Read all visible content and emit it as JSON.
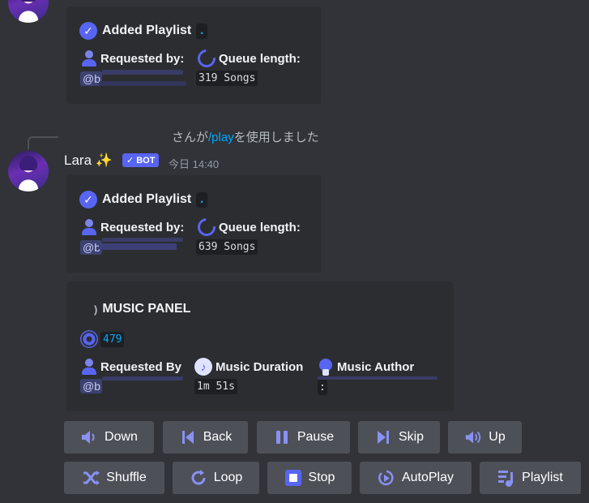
{
  "message_top": {
    "embed": {
      "title": "Added Playlist",
      "title_code": ".",
      "requested_label": "Requested by:",
      "mention": "@b",
      "queue_label": "Queue length:",
      "queue_value": "319 Songs"
    }
  },
  "system_line": {
    "prefix": "さんが",
    "command": "/play",
    "suffix": "を使用しました"
  },
  "message_main": {
    "author": "Lara",
    "author_emoji": "✨",
    "bot_tag": "BOT",
    "timestamp": "今日 14:40",
    "embed1": {
      "title": "Added Playlist",
      "title_code": ".",
      "requested_label": "Requested by:",
      "mention": "@b",
      "queue_label": "Queue length:",
      "queue_value": "639 Songs"
    },
    "embed2": {
      "title": "MUSIC PANEL",
      "track_number": "479",
      "requested_label": "Requested By",
      "mention": "@b",
      "duration_label": "Music Duration",
      "duration_value": "1m 51s",
      "author_label": "Music Author",
      "author_value": ":"
    }
  },
  "buttons_row1": [
    {
      "label": "Down",
      "icon": "volume-down-icon"
    },
    {
      "label": "Back",
      "icon": "previous-track-icon"
    },
    {
      "label": "Pause",
      "icon": "pause-icon"
    },
    {
      "label": "Skip",
      "icon": "next-track-icon"
    },
    {
      "label": "Up",
      "icon": "volume-up-icon"
    }
  ],
  "buttons_row2": [
    {
      "label": "Shuffle",
      "icon": "shuffle-icon"
    },
    {
      "label": "Loop",
      "icon": "loop-icon"
    },
    {
      "label": "Stop",
      "icon": "stop-icon"
    },
    {
      "label": "AutoPlay",
      "icon": "autoplay-icon"
    },
    {
      "label": "Playlist",
      "icon": "playlist-icon"
    }
  ],
  "colors": {
    "background": "#313338",
    "embed_bg": "#2b2d31",
    "blurple": "#5865f2",
    "button_bg": "#4e5058",
    "link_blue": "#00a8fc"
  }
}
